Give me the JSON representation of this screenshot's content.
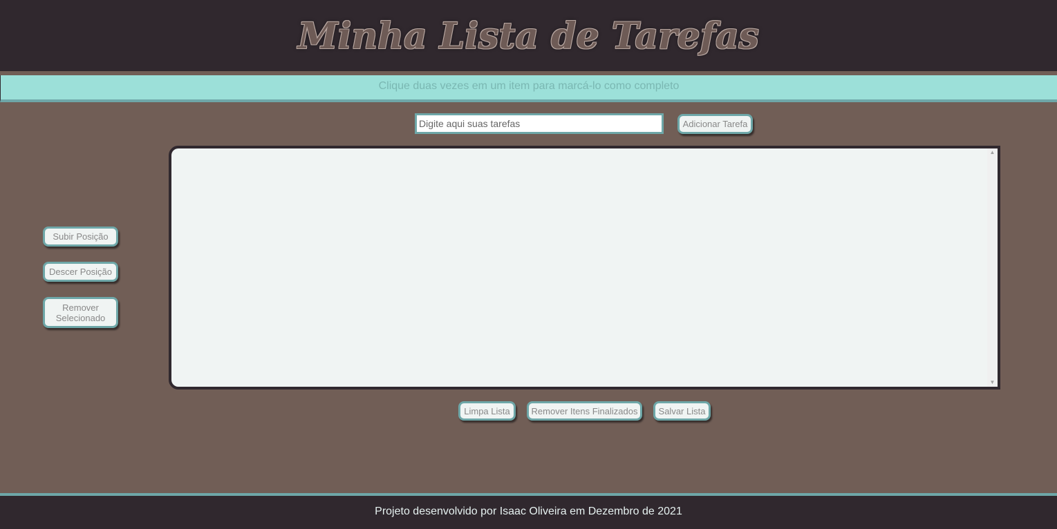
{
  "header": {
    "title": "Minha Lista de Tarefas"
  },
  "hint": {
    "text": "Clique duas vezes em um item para marcá-lo como completo"
  },
  "form": {
    "input_placeholder": "Digite aqui suas tarefas",
    "input_value": "",
    "add_label": "Adicionar Tarefa"
  },
  "side_controls": {
    "move_up_label": "Subir Posição",
    "move_down_label": "Descer Posição",
    "remove_selected_label": "Remover Selecionado"
  },
  "task_list": {
    "items": [],
    "scroll_up_icon": "triangle-up-icon",
    "scroll_down_icon": "triangle-down-icon"
  },
  "bottom_controls": {
    "clear_label": "Limpa Lista",
    "remove_done_label": "Remover Itens Finalizados",
    "save_label": "Salvar Lista"
  },
  "footer": {
    "text": "Projeto desenvolvido por Isaac Oliveira em Dezembro de 2021"
  },
  "colors": {
    "page_bg": "#715e56",
    "header_bg": "#30282e",
    "accent_teal": "#6ea7a8",
    "hint_bg": "#9ce0d9",
    "list_bg": "#f0f4f3"
  }
}
